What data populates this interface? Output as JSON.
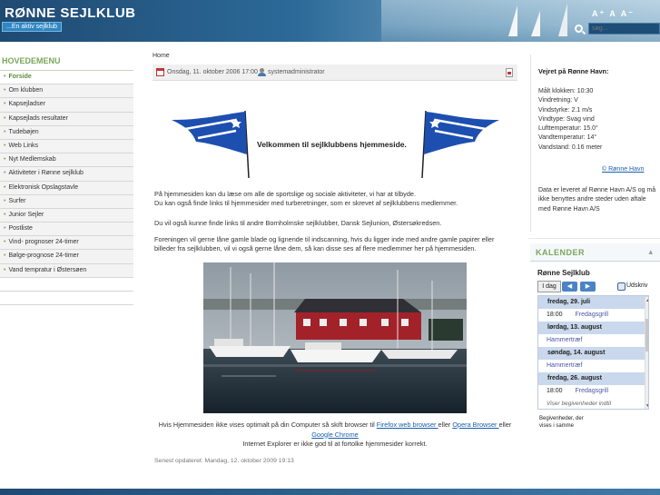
{
  "header": {
    "site_title": "RØNNE SEJLKLUB",
    "tagline": "...En aktiv sejlklub",
    "font_size_controls": "A⁺ A A⁻",
    "search_placeholder": "søg..."
  },
  "menu": {
    "title": "HOVEDEMENU",
    "items": [
      {
        "label": "Forside",
        "active": true
      },
      {
        "label": "Om klubben"
      },
      {
        "label": "Kapsejladser"
      },
      {
        "label": "Kapsejlads resultater"
      },
      {
        "label": "Tudebøjen"
      },
      {
        "label": "Web Links"
      },
      {
        "label": "Nyt Medlemskab"
      },
      {
        "label": "Aktiviteter i Rønne sejlklub"
      },
      {
        "label": "Elektronisk Opslagstavle"
      },
      {
        "label": "Surfer"
      },
      {
        "label": "Junior Sejler"
      },
      {
        "label": "Postliste"
      },
      {
        "label": "Vind- prognoser 24-timer"
      },
      {
        "label": "Bølge-prognose 24-timer"
      },
      {
        "label": "Vand tempratur i Østersøen"
      }
    ]
  },
  "article": {
    "breadcrumb": "Home",
    "date": "Onsdag, 11. oktober 2006 17:00",
    "author": "systemadministrator",
    "welcome": "Velkommen til sejlklubbens hjemmeside.",
    "para1_line1": "På hjemmesiden kan du læse om alle de sportslige og sociale aktiviteter, vi har at tilbyde.",
    "para1_line2": "Du kan også finde links til hjemmesider med turberetninger, som er skrevet af sejlklubbens medlemmer.",
    "para2": "Du vil også kunne finde links til andre Bornholmske sejlklubber, Dansk Sejlunion, Østersøkredsen.",
    "para3_line1": "Foreningen vil gerne låne gamle blade og lignende til indscanning, hvis du ligger inde med andre gamle papirer eller",
    "para3_line2": "billeder fra sejlklubben, vil vi også gerne låne dem, så kan disse ses af flere medlemmer her på hjemmesiden.",
    "browser_pre": "Hvis Hjemmesiden ikke vises optimalt på din Computer så skift browser til ",
    "firefox_link": "Firefox web browser ",
    "eller1": "eller ",
    "opera_link": "Opera Browser ",
    "eller2": "eller",
    "chrome_link": "Google Chrome ",
    "ie_note": "Internet Explorer er ikke god til at fortolke hjemmesider korrekt.",
    "updated": "Senest opdateret: Mandag, 12. oktober 2009 19:13"
  },
  "weather": {
    "title": "Vejret på Rønne Havn:",
    "lines": [
      "Målt klokken: 10:30",
      "Vindretning: V",
      "Vindstyrke: 2.1 m/s",
      "Vindtype: Svag vind",
      "Lufttemperatur: 15.0°",
      "Vandtemperatur: 14°",
      "Vandstand: 0.16 meter"
    ],
    "copyright": "© Rønne Havn",
    "note": "Data er leveret af Rønne Havn A/S og må ikke benyttes andre steder uden aftale med Rønne Havn A/S"
  },
  "calendar": {
    "title": "KALENDER",
    "name": "Rønne Sejlklub",
    "today": "I dag",
    "print": "Udskriv",
    "agenda": [
      {
        "date": "fredag, 29. juli",
        "time": "18:00",
        "event": "Fredagsgrill"
      },
      {
        "date": "lørdag, 13. august",
        "time": "",
        "event": "Hammertræf"
      },
      {
        "date": "søndag, 14. august",
        "time": "",
        "event": "Hammertræf"
      },
      {
        "date": "fredag, 26. august",
        "time": "18:00",
        "event": "Fredagsgrill"
      }
    ],
    "more": "Viser begivenheder indtil",
    "footer": "Begivenheder, der vises i samme"
  },
  "colors": {
    "accent_green": "#7aa65a",
    "header_blue": "#1f4a72",
    "link_blue": "#1a5fae"
  }
}
